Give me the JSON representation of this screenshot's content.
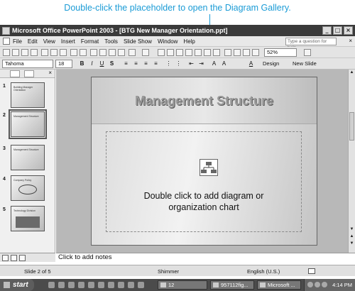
{
  "callout": {
    "text": "Double-click the placeholder to open the Diagram Gallery."
  },
  "window": {
    "title": "Microsoft Office PowerPoint 2003 - [BTG New Manager Orientation.ppt]"
  },
  "menu": {
    "items": [
      "File",
      "Edit",
      "View",
      "Insert",
      "Format",
      "Tools",
      "Slide Show",
      "Window",
      "Help"
    ],
    "help_placeholder": "Type a question for help"
  },
  "toolbar": {
    "zoom": "52%",
    "font_name": "Tahoma",
    "font_size": "18",
    "design_label": "Design",
    "new_slide_label": "New Slide"
  },
  "slides": [
    {
      "number": "1",
      "title": "Building Manager Orientation"
    },
    {
      "number": "2",
      "title": "Management Structure"
    },
    {
      "number": "3",
      "title": "Management Structure"
    },
    {
      "number": "4",
      "title": "Company Policy"
    },
    {
      "number": "5",
      "title": "Technology Division"
    }
  ],
  "slide": {
    "title": "Management Structure",
    "placeholder_line1": "Double click to add diagram or",
    "placeholder_line2": "organization chart"
  },
  "notes": {
    "placeholder": "Click to add notes"
  },
  "status": {
    "slide_position": "Slide 2 of 5",
    "design": "Shimmer",
    "language": "English (U.S.)"
  },
  "taskbar": {
    "start": "start",
    "tasks": [
      "12",
      "957112fig...",
      "Microsoft ..."
    ],
    "clock": "4:14 PM"
  },
  "icons": [
    "diagram-icon",
    "close-icon",
    "minimize-icon",
    "maximize-icon",
    "windows-flag-icon"
  ]
}
